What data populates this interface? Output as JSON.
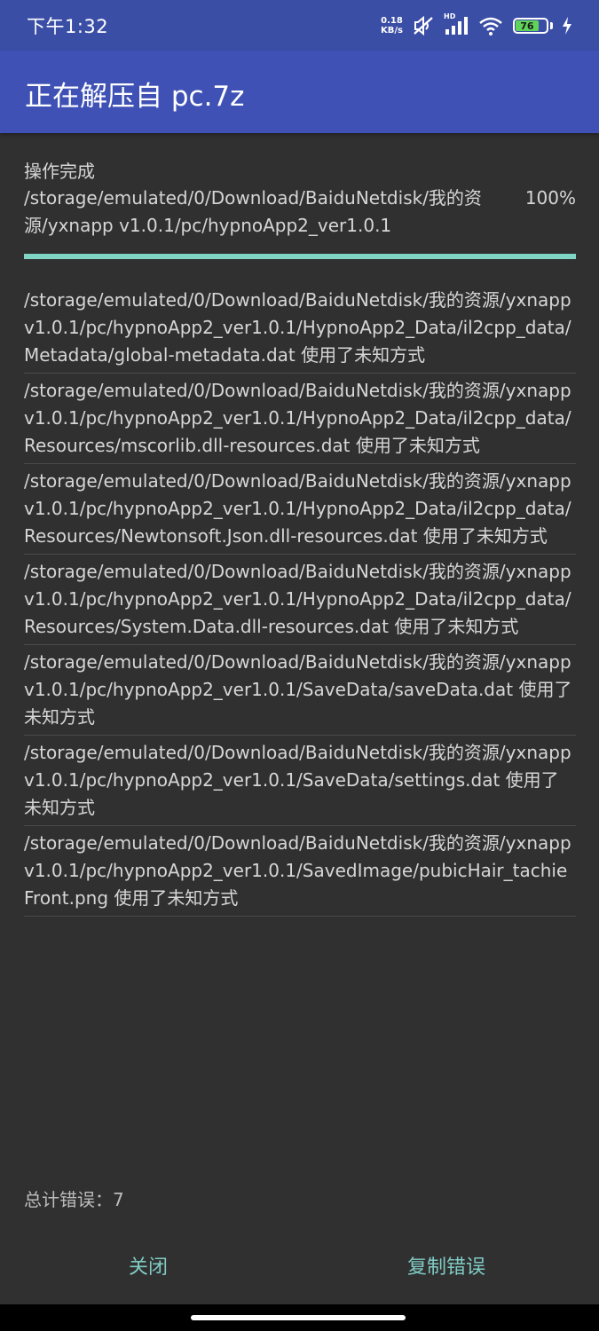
{
  "status_bar": {
    "time": "下午1:32",
    "net_speed_value": "0.18",
    "net_speed_unit": "KB/s",
    "hd_label": "HD",
    "battery_level": "76",
    "icons": [
      "mute-icon",
      "signal-icon",
      "wifi-icon",
      "battery-icon",
      "charging-icon"
    ]
  },
  "app_bar": {
    "title": "正在解压自 pc.7z"
  },
  "operation": {
    "status": "操作完成",
    "current_path": "/storage/emulated/0/Download/BaiduNetdisk/我的资源/yxnapp v1.0.1/pc/hypnoApp2_ver1.0.1",
    "percent": "100%",
    "progress_fraction": 1.0
  },
  "errors": [
    "/storage/emulated/0/Download/BaiduNetdisk/我的资源/yxnapp v1.0.1/pc/hypnoApp2_ver1.0.1/HypnoApp2_Data/il2cpp_data/Metadata/global-metadata.dat 使用了未知方式",
    "/storage/emulated/0/Download/BaiduNetdisk/我的资源/yxnapp v1.0.1/pc/hypnoApp2_ver1.0.1/HypnoApp2_Data/il2cpp_data/Resources/mscorlib.dll-resources.dat 使用了未知方式",
    "/storage/emulated/0/Download/BaiduNetdisk/我的资源/yxnapp v1.0.1/pc/hypnoApp2_ver1.0.1/HypnoApp2_Data/il2cpp_data/Resources/Newtonsoft.Json.dll-resources.dat 使用了未知方式",
    "/storage/emulated/0/Download/BaiduNetdisk/我的资源/yxnapp v1.0.1/pc/hypnoApp2_ver1.0.1/HypnoApp2_Data/il2cpp_data/Resources/System.Data.dll-resources.dat 使用了未知方式",
    "/storage/emulated/0/Download/BaiduNetdisk/我的资源/yxnapp v1.0.1/pc/hypnoApp2_ver1.0.1/SaveData/saveData.dat 使用了未知方式",
    "/storage/emulated/0/Download/BaiduNetdisk/我的资源/yxnapp v1.0.1/pc/hypnoApp2_ver1.0.1/SaveData/settings.dat 使用了未知方式",
    "/storage/emulated/0/Download/BaiduNetdisk/我的资源/yxnapp v1.0.1/pc/hypnoApp2_ver1.0.1/SavedImage/pubicHair_tachieFront.png 使用了未知方式"
  ],
  "footer": {
    "total_errors": "总计错误：7",
    "close_label": "关闭",
    "copy_label": "复制错误"
  },
  "colors": {
    "status_bar": "#3b4ea6",
    "app_bar": "#3f51b5",
    "background": "#303030",
    "accent": "#80cbc4",
    "progress": "#7fd4c4"
  }
}
